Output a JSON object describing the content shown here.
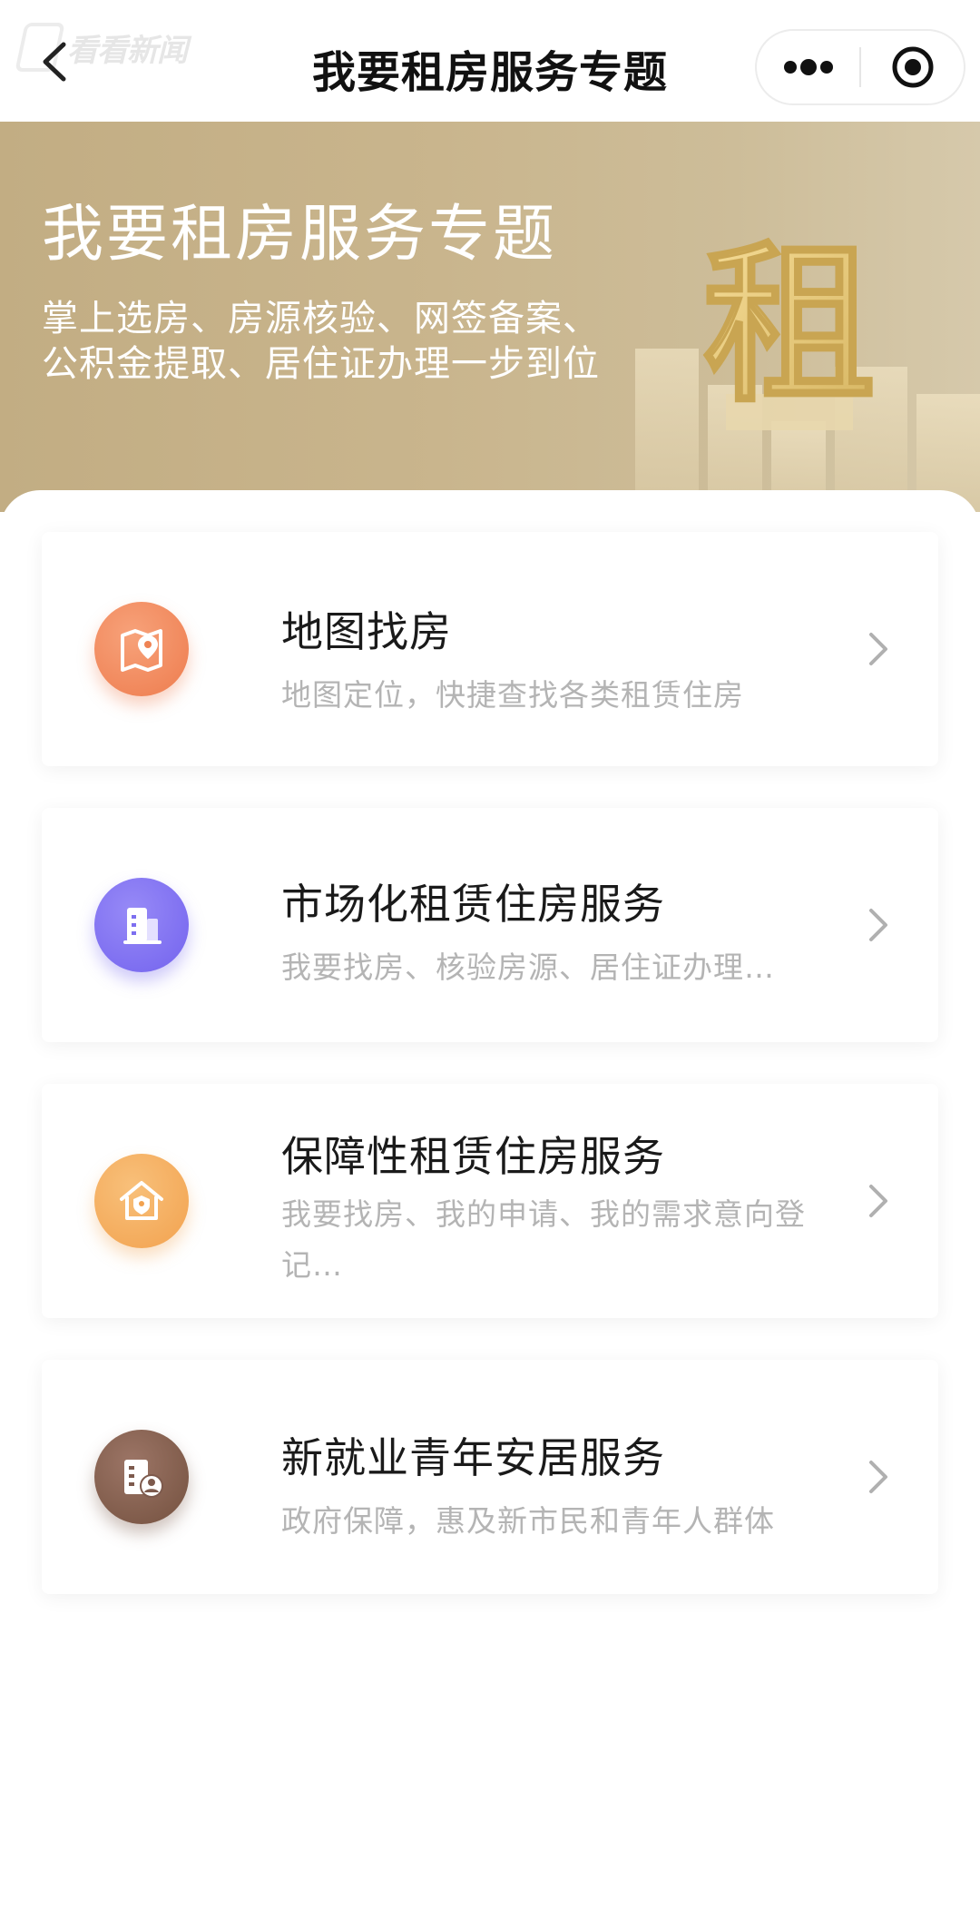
{
  "navbar": {
    "title": "我要租房服务专题",
    "watermark_text": "看看新闻",
    "back_icon": "chevron-left-icon",
    "more_icon": "more-dots-icon",
    "close_icon": "target-close-icon"
  },
  "banner": {
    "title": "我要租房服务专题",
    "subtitle_line1": "掌上选房、房源核验、网签备案、",
    "subtitle_line2": "公积金提取、居住证办理一步到位",
    "art_character": "租",
    "background_color": "#c6b389"
  },
  "services": [
    {
      "title": "地图找房",
      "desc": "地图定位，快捷查找各类租赁住房",
      "icon": "map-pin-icon",
      "icon_color": "#f0875a"
    },
    {
      "title": "市场化租赁住房服务",
      "desc": "我要找房、核验房源、居住证办理…",
      "icon": "building-icon",
      "icon_color": "#7b6cf0"
    },
    {
      "title": "保障性租赁住房服务",
      "desc": "我要找房、我的申请、我的需求意向登记…",
      "icon": "shield-house-icon",
      "icon_color": "#f4a95a"
    },
    {
      "title": "新就业青年安居服务",
      "desc": "政府保障，惠及新市民和青年人群体",
      "icon": "building-person-icon",
      "icon_color": "#7d5a4d"
    }
  ]
}
